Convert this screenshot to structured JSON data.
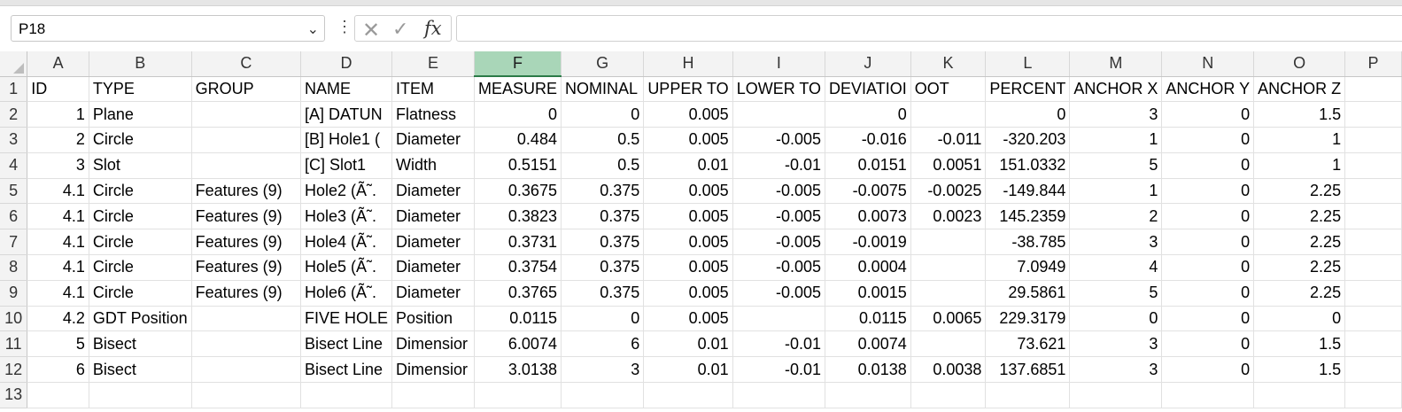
{
  "name_box": {
    "value": "P18"
  },
  "formula_bar": {
    "value": ""
  },
  "columns": [
    "A",
    "B",
    "C",
    "D",
    "E",
    "F",
    "G",
    "H",
    "I",
    "J",
    "K",
    "L",
    "M",
    "N",
    "O",
    "P"
  ],
  "selected_column": "F",
  "rows": [
    {
      "n": "1",
      "cells": [
        [
          "ID",
          "txt"
        ],
        [
          "TYPE",
          "txt"
        ],
        [
          "GROUP",
          "txt"
        ],
        [
          "NAME",
          "txt"
        ],
        [
          "ITEM",
          "txt"
        ],
        [
          "MEASURE",
          "txt"
        ],
        [
          "NOMINAL",
          "txt"
        ],
        [
          "UPPER TO",
          "txt"
        ],
        [
          "LOWER TO",
          "txt"
        ],
        [
          "DEVIATIOI",
          "txt"
        ],
        [
          "OOT",
          "txt"
        ],
        [
          "PERCENT",
          "txt"
        ],
        [
          "ANCHOR X",
          "txt"
        ],
        [
          "ANCHOR Y",
          "txt"
        ],
        [
          "ANCHOR Z",
          "txt"
        ],
        [
          "",
          ""
        ]
      ]
    },
    {
      "n": "2",
      "cells": [
        [
          "1",
          "num"
        ],
        [
          "Plane",
          "txt"
        ],
        [
          "",
          "txt"
        ],
        [
          "[A] DATUN",
          "txt"
        ],
        [
          "Flatness",
          "txt"
        ],
        [
          "0",
          "num"
        ],
        [
          "0",
          "num"
        ],
        [
          "0.005",
          "num"
        ],
        [
          "",
          "num"
        ],
        [
          "0",
          "num"
        ],
        [
          "",
          "num"
        ],
        [
          "0",
          "num"
        ],
        [
          "3",
          "num"
        ],
        [
          "0",
          "num"
        ],
        [
          "1.5",
          "num"
        ],
        [
          "",
          ""
        ]
      ]
    },
    {
      "n": "3",
      "cells": [
        [
          "2",
          "num"
        ],
        [
          "Circle",
          "txt"
        ],
        [
          "",
          "txt"
        ],
        [
          "[B] Hole1 (",
          "txt"
        ],
        [
          "Diameter",
          "txt"
        ],
        [
          "0.484",
          "num"
        ],
        [
          "0.5",
          "num"
        ],
        [
          "0.005",
          "num"
        ],
        [
          "-0.005",
          "num"
        ],
        [
          "-0.016",
          "num"
        ],
        [
          "-0.011",
          "num"
        ],
        [
          "-320.203",
          "num"
        ],
        [
          "1",
          "num"
        ],
        [
          "0",
          "num"
        ],
        [
          "1",
          "num"
        ],
        [
          "",
          ""
        ]
      ]
    },
    {
      "n": "4",
      "cells": [
        [
          "3",
          "num"
        ],
        [
          "Slot",
          "txt"
        ],
        [
          "",
          "txt"
        ],
        [
          "[C] Slot1",
          "txt"
        ],
        [
          "Width",
          "txt"
        ],
        [
          "0.5151",
          "num"
        ],
        [
          "0.5",
          "num"
        ],
        [
          "0.01",
          "num"
        ],
        [
          "-0.01",
          "num"
        ],
        [
          "0.0151",
          "num"
        ],
        [
          "0.0051",
          "num"
        ],
        [
          "151.0332",
          "num"
        ],
        [
          "5",
          "num"
        ],
        [
          "0",
          "num"
        ],
        [
          "1",
          "num"
        ],
        [
          "",
          ""
        ]
      ]
    },
    {
      "n": "5",
      "cells": [
        [
          "4.1",
          "num"
        ],
        [
          "Circle",
          "txt"
        ],
        [
          "Features (9)",
          "txt"
        ],
        [
          "Hole2 (Ã˜.",
          "txt"
        ],
        [
          "Diameter",
          "txt"
        ],
        [
          "0.3675",
          "num"
        ],
        [
          "0.375",
          "num"
        ],
        [
          "0.005",
          "num"
        ],
        [
          "-0.005",
          "num"
        ],
        [
          "-0.0075",
          "num"
        ],
        [
          "-0.0025",
          "num"
        ],
        [
          "-149.844",
          "num"
        ],
        [
          "1",
          "num"
        ],
        [
          "0",
          "num"
        ],
        [
          "2.25",
          "num"
        ],
        [
          "",
          ""
        ]
      ]
    },
    {
      "n": "6",
      "cells": [
        [
          "4.1",
          "num"
        ],
        [
          "Circle",
          "txt"
        ],
        [
          "Features (9)",
          "txt"
        ],
        [
          "Hole3 (Ã˜.",
          "txt"
        ],
        [
          "Diameter",
          "txt"
        ],
        [
          "0.3823",
          "num"
        ],
        [
          "0.375",
          "num"
        ],
        [
          "0.005",
          "num"
        ],
        [
          "-0.005",
          "num"
        ],
        [
          "0.0073",
          "num"
        ],
        [
          "0.0023",
          "num"
        ],
        [
          "145.2359",
          "num"
        ],
        [
          "2",
          "num"
        ],
        [
          "0",
          "num"
        ],
        [
          "2.25",
          "num"
        ],
        [
          "",
          ""
        ]
      ]
    },
    {
      "n": "7",
      "cells": [
        [
          "4.1",
          "num"
        ],
        [
          "Circle",
          "txt"
        ],
        [
          "Features (9)",
          "txt"
        ],
        [
          "Hole4 (Ã˜.",
          "txt"
        ],
        [
          "Diameter",
          "txt"
        ],
        [
          "0.3731",
          "num"
        ],
        [
          "0.375",
          "num"
        ],
        [
          "0.005",
          "num"
        ],
        [
          "-0.005",
          "num"
        ],
        [
          "-0.0019",
          "num"
        ],
        [
          "",
          "num"
        ],
        [
          "-38.785",
          "num"
        ],
        [
          "3",
          "num"
        ],
        [
          "0",
          "num"
        ],
        [
          "2.25",
          "num"
        ],
        [
          "",
          ""
        ]
      ]
    },
    {
      "n": "8",
      "cells": [
        [
          "4.1",
          "num"
        ],
        [
          "Circle",
          "txt"
        ],
        [
          "Features (9)",
          "txt"
        ],
        [
          "Hole5 (Ã˜.",
          "txt"
        ],
        [
          "Diameter",
          "txt"
        ],
        [
          "0.3754",
          "num"
        ],
        [
          "0.375",
          "num"
        ],
        [
          "0.005",
          "num"
        ],
        [
          "-0.005",
          "num"
        ],
        [
          "0.0004",
          "num"
        ],
        [
          "",
          "num"
        ],
        [
          "7.0949",
          "num"
        ],
        [
          "4",
          "num"
        ],
        [
          "0",
          "num"
        ],
        [
          "2.25",
          "num"
        ],
        [
          "",
          ""
        ]
      ]
    },
    {
      "n": "9",
      "cells": [
        [
          "4.1",
          "num"
        ],
        [
          "Circle",
          "txt"
        ],
        [
          "Features (9)",
          "txt"
        ],
        [
          "Hole6 (Ã˜.",
          "txt"
        ],
        [
          "Diameter",
          "txt"
        ],
        [
          "0.3765",
          "num"
        ],
        [
          "0.375",
          "num"
        ],
        [
          "0.005",
          "num"
        ],
        [
          "-0.005",
          "num"
        ],
        [
          "0.0015",
          "num"
        ],
        [
          "",
          "num"
        ],
        [
          "29.5861",
          "num"
        ],
        [
          "5",
          "num"
        ],
        [
          "0",
          "num"
        ],
        [
          "2.25",
          "num"
        ],
        [
          "",
          ""
        ]
      ]
    },
    {
      "n": "10",
      "cells": [
        [
          "4.2",
          "num"
        ],
        [
          "GDT Position",
          "txt"
        ],
        [
          "",
          "txt"
        ],
        [
          "FIVE HOLE",
          "txt"
        ],
        [
          "Position",
          "txt"
        ],
        [
          "0.0115",
          "num"
        ],
        [
          "0",
          "num"
        ],
        [
          "0.005",
          "num"
        ],
        [
          "",
          "num"
        ],
        [
          "0.0115",
          "num"
        ],
        [
          "0.0065",
          "num"
        ],
        [
          "229.3179",
          "num"
        ],
        [
          "0",
          "num"
        ],
        [
          "0",
          "num"
        ],
        [
          "0",
          "num"
        ],
        [
          "",
          ""
        ]
      ]
    },
    {
      "n": "11",
      "cells": [
        [
          "5",
          "num"
        ],
        [
          "Bisect",
          "txt"
        ],
        [
          "",
          "txt"
        ],
        [
          "Bisect Line",
          "txt"
        ],
        [
          "Dimensior",
          "txt"
        ],
        [
          "6.0074",
          "num"
        ],
        [
          "6",
          "num"
        ],
        [
          "0.01",
          "num"
        ],
        [
          "-0.01",
          "num"
        ],
        [
          "0.0074",
          "num"
        ],
        [
          "",
          "num"
        ],
        [
          "73.621",
          "num"
        ],
        [
          "3",
          "num"
        ],
        [
          "0",
          "num"
        ],
        [
          "1.5",
          "num"
        ],
        [
          "",
          ""
        ]
      ]
    },
    {
      "n": "12",
      "cells": [
        [
          "6",
          "num"
        ],
        [
          "Bisect",
          "txt"
        ],
        [
          "",
          "txt"
        ],
        [
          "Bisect Line",
          "txt"
        ],
        [
          "Dimensior",
          "txt"
        ],
        [
          "3.0138",
          "num"
        ],
        [
          "3",
          "num"
        ],
        [
          "0.01",
          "num"
        ],
        [
          "-0.01",
          "num"
        ],
        [
          "0.0138",
          "num"
        ],
        [
          "0.0038",
          "num"
        ],
        [
          "137.6851",
          "num"
        ],
        [
          "3",
          "num"
        ],
        [
          "0",
          "num"
        ],
        [
          "1.5",
          "num"
        ],
        [
          "",
          ""
        ]
      ]
    },
    {
      "n": "13",
      "cells": [
        [
          "",
          ""
        ],
        [
          "",
          ""
        ],
        [
          "",
          ""
        ],
        [
          "",
          ""
        ],
        [
          "",
          ""
        ],
        [
          "",
          ""
        ],
        [
          "",
          ""
        ],
        [
          "",
          ""
        ],
        [
          "",
          ""
        ],
        [
          "",
          ""
        ],
        [
          "",
          ""
        ],
        [
          "",
          ""
        ],
        [
          "",
          ""
        ],
        [
          "",
          ""
        ],
        [
          "",
          ""
        ],
        [
          "",
          ""
        ]
      ]
    }
  ]
}
